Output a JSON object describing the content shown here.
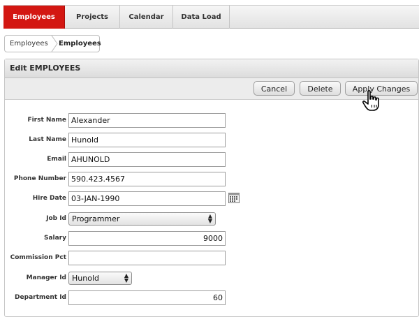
{
  "tabs": [
    {
      "label": "Employees",
      "active": true
    },
    {
      "label": "Projects",
      "active": false
    },
    {
      "label": "Calendar",
      "active": false
    },
    {
      "label": "Data Load",
      "active": false
    }
  ],
  "breadcrumb": {
    "parent": "Employees",
    "current": "Employees"
  },
  "region": {
    "title": "Edit EMPLOYEES"
  },
  "buttons": {
    "cancel": "Cancel",
    "delete": "Delete",
    "apply": "Apply Changes"
  },
  "form": {
    "first_name": {
      "label": "First Name",
      "value": "Alexander"
    },
    "last_name": {
      "label": "Last Name",
      "value": "Hunold"
    },
    "email": {
      "label": "Email",
      "value": "AHUNOLD"
    },
    "phone": {
      "label": "Phone Number",
      "value": "590.423.4567"
    },
    "hire_date": {
      "label": "Hire Date",
      "value": "03-JAN-1990"
    },
    "job_id": {
      "label": "Job Id",
      "value": "Programmer"
    },
    "salary": {
      "label": "Salary",
      "value": "9000"
    },
    "commission": {
      "label": "Commission Pct",
      "value": ""
    },
    "manager": {
      "label": "Manager Id",
      "value": "Hunold"
    },
    "department": {
      "label": "Department Id",
      "value": "60"
    }
  },
  "icons": {
    "calendar": "calendar-icon",
    "cursor": "hand-pointer-icon"
  },
  "colors": {
    "active_tab": "#d31712"
  }
}
